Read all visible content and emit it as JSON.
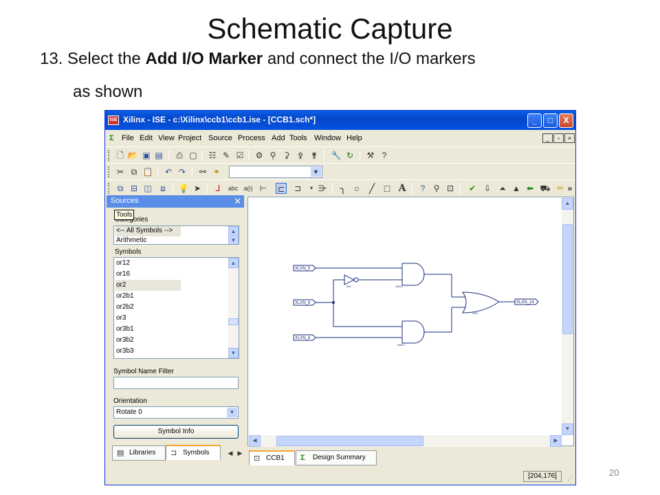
{
  "slide": {
    "title": "Schematic Capture",
    "step_prefix": "13. Select the ",
    "step_bold": "Add I/O Marker",
    "step_rest": " and connect the I/O markers",
    "step_line2": "as shown",
    "page_number": "20"
  },
  "window": {
    "title": "Xilinx - ISE - c:\\Xilinx\\ccb1\\ccb1.ise - [CCB1.sch*]",
    "app_icon_text": "ISE",
    "min_label": "_",
    "max_label": "□",
    "close_label": "X"
  },
  "menu": {
    "items": [
      "File",
      "Edit",
      "View",
      "Project",
      "Source",
      "Process",
      "Add",
      "Tools",
      "Window",
      "Help"
    ]
  },
  "sources_panel": {
    "title": "Sources",
    "tooltip": "Tools",
    "categories_label": "Categories",
    "categories": [
      "<-- All Symbols -->",
      "Arithmetic"
    ],
    "symbols_label": "Symbols",
    "symbols": [
      "or12",
      "or16",
      "or2",
      "or2b1",
      "or2b2",
      "or3",
      "or3b1",
      "or3b2",
      "or3b3"
    ],
    "selected_symbol": "or2",
    "filter_label": "Symbol Name Filter",
    "filter_value": "",
    "orientation_label": "Orientation",
    "orientation_value": "Rotate 0",
    "symbol_info_button": "Symbol Info"
  },
  "bottom_tabs_left": [
    {
      "label": "Libraries",
      "icon": "libraries-icon"
    },
    {
      "label": "Symbols",
      "icon": "symbols-icon",
      "active": true
    }
  ],
  "bottom_tabs_right": [
    {
      "label": "CCB1",
      "icon": "schematic-icon",
      "active": true
    },
    {
      "label": "Design Summary",
      "icon": "sigma-icon"
    }
  ],
  "schematic": {
    "markers": [
      "XLXN_5",
      "XLXN_6",
      "XLXN_8",
      "XLXN_14"
    ],
    "gates": {
      "inv": "INV",
      "and_top": "AND2",
      "and_bottom": "AND2",
      "or": "OR2"
    }
  },
  "status": {
    "coordinates": "[204,176]"
  }
}
